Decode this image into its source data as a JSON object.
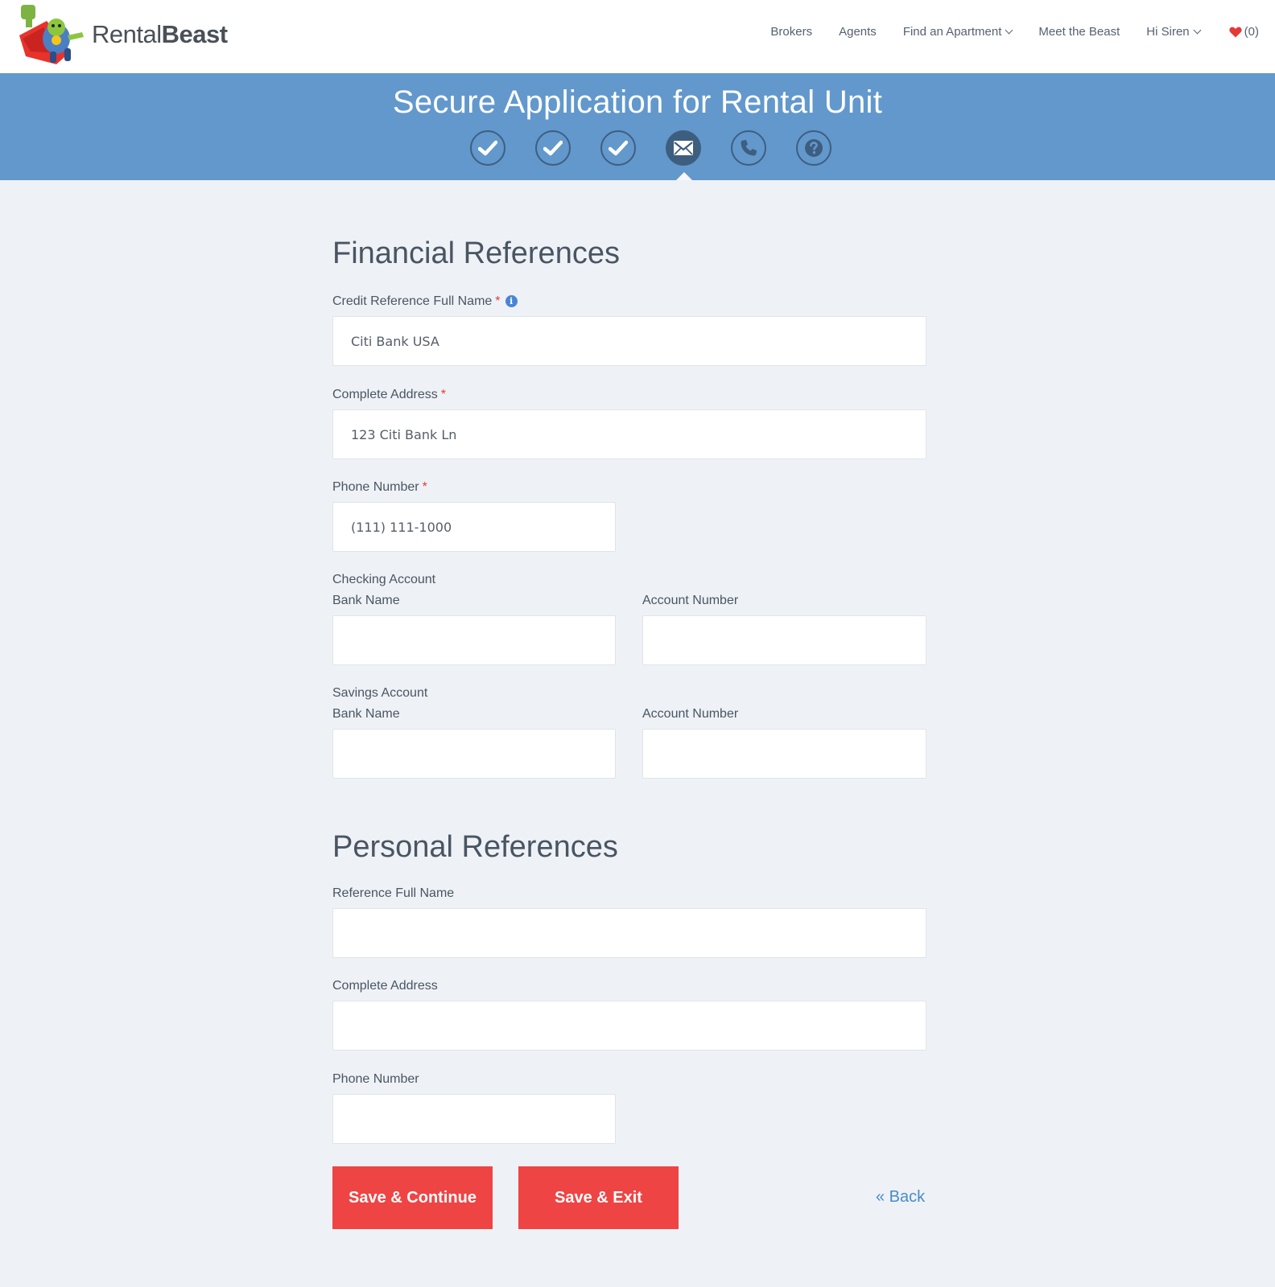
{
  "brand": {
    "name_light": "Rental",
    "name_bold": "Beast"
  },
  "nav": {
    "brokers": "Brokers",
    "agents": "Agents",
    "find_apartment": "Find an Apartment",
    "meet": "Meet the Beast",
    "user": "Hi Siren",
    "favorites_count": "(0)"
  },
  "banner": {
    "title": "Secure Application for Rental Unit",
    "steps": [
      {
        "icon": "check-icon",
        "state": "completed"
      },
      {
        "icon": "check-icon",
        "state": "completed"
      },
      {
        "icon": "check-icon",
        "state": "completed"
      },
      {
        "icon": "envelope-icon",
        "state": "active"
      },
      {
        "icon": "phone-icon",
        "state": "pending"
      },
      {
        "icon": "question-icon",
        "state": "pending"
      }
    ]
  },
  "financial": {
    "title": "Financial References",
    "credit_name_label": "Credit Reference Full Name",
    "credit_name_value": "Citi Bank USA",
    "address_label": "Complete Address",
    "address_value": "123 Citi Bank Ln",
    "phone_label": "Phone Number",
    "phone_value": "(111) 111-1000",
    "checking_label": "Checking Account",
    "savings_label": "Savings Account",
    "bank_name_label": "Bank Name",
    "account_number_label": "Account Number",
    "required_mark": "*"
  },
  "personal": {
    "title": "Personal References",
    "name_label": "Reference Full Name",
    "address_label": "Complete Address",
    "phone_label": "Phone Number"
  },
  "actions": {
    "save_continue": "Save & Continue",
    "save_exit": "Save & Exit",
    "back": "« Back"
  },
  "colors": {
    "banner": "#6298cc",
    "step_icon": "#3e5e80",
    "button": "#ef4444",
    "link": "#4a8bc7",
    "required": "#e53935"
  }
}
